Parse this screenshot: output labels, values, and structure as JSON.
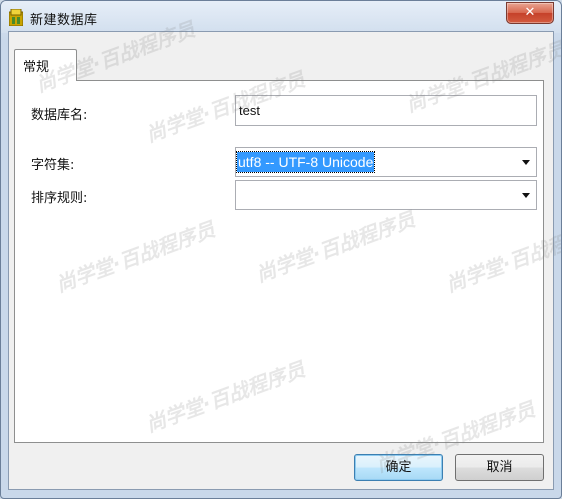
{
  "window": {
    "title": "新建数据库",
    "close_glyph": "✕"
  },
  "tabs": [
    {
      "label": "常规",
      "active": true
    }
  ],
  "form": {
    "database_name": {
      "label": "数据库名:",
      "value": "test"
    },
    "charset": {
      "label": "字符集:",
      "value": "utf8 -- UTF-8 Unicode"
    },
    "collation": {
      "label": "排序规则:",
      "value": ""
    }
  },
  "buttons": {
    "ok": "确定",
    "cancel": "取消"
  },
  "watermark": {
    "text": "尚学堂·百战程序员"
  },
  "colors": {
    "selection": "#3399ff",
    "close_button": "#c5412a"
  }
}
